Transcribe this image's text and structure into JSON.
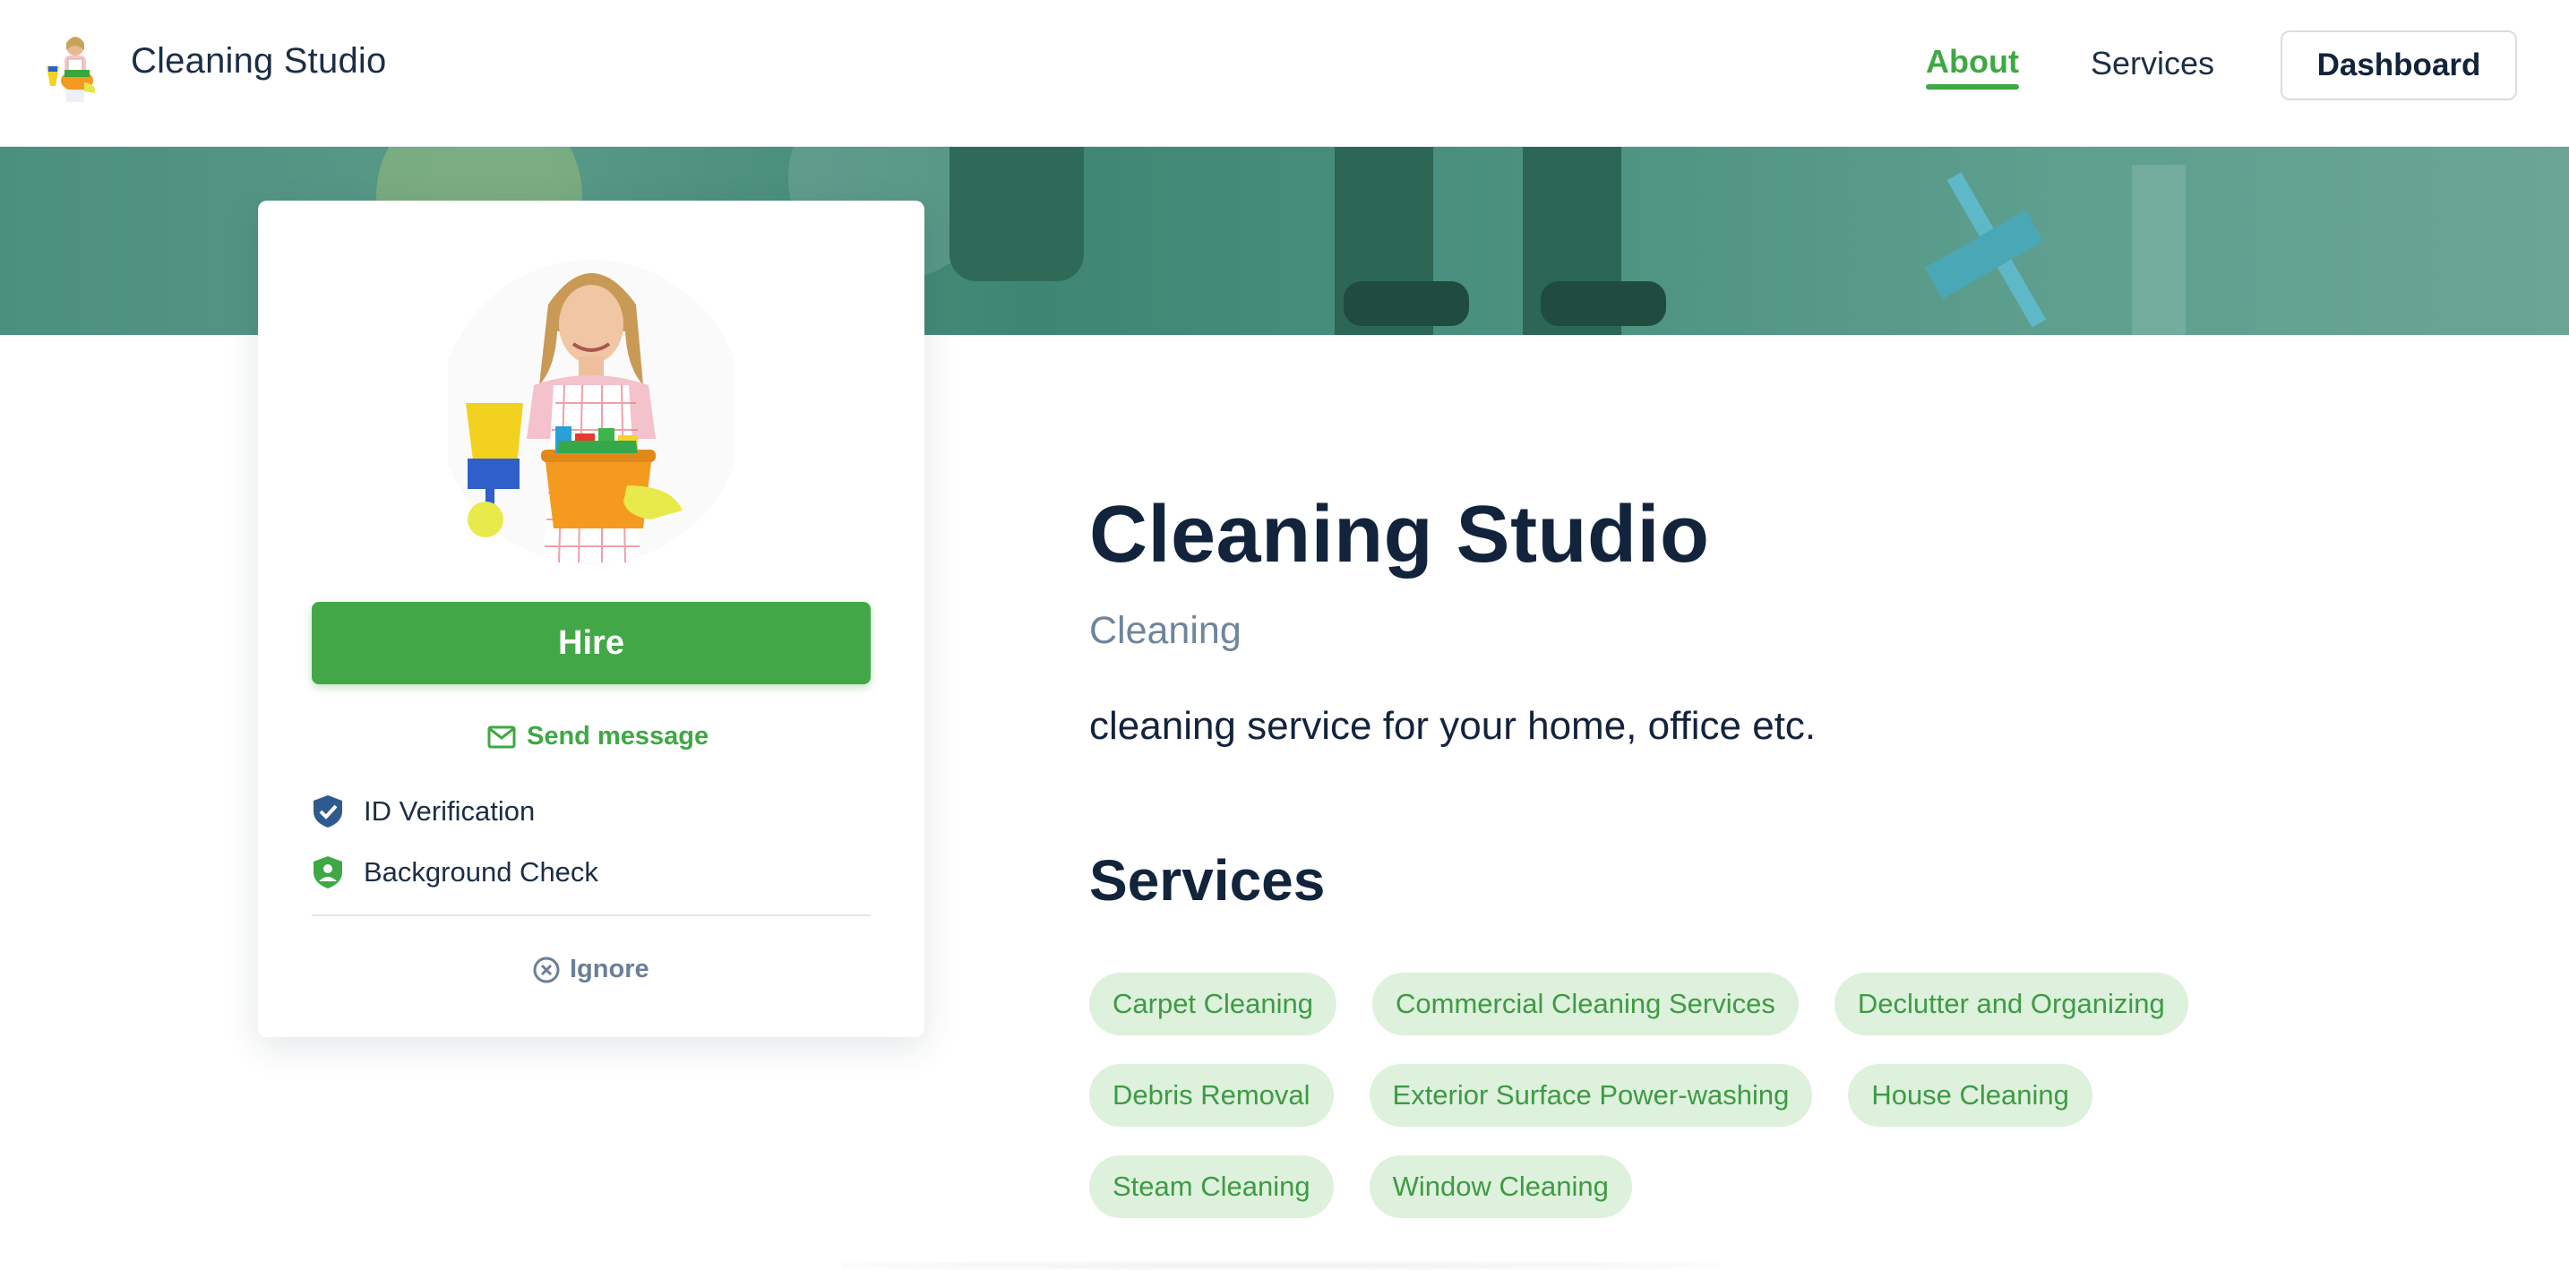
{
  "header": {
    "brand": "Cleaning Studio",
    "logo_icon": "cleaning-lady-logo",
    "nav": {
      "about": "About",
      "services": "Services"
    },
    "dashboard_label": "Dashboard"
  },
  "card": {
    "hire_label": "Hire",
    "send_message_label": "Send message",
    "verifications": [
      {
        "label": "ID Verification",
        "icon": "shield-check-icon",
        "color": "#2e5a8e"
      },
      {
        "label": "Background Check",
        "icon": "shield-user-icon",
        "color": "#3fa844"
      }
    ],
    "ignore_label": "Ignore"
  },
  "profile": {
    "name": "Cleaning Studio",
    "category": "Cleaning",
    "description": "cleaning service for your home, office etc."
  },
  "services": {
    "heading": "Services",
    "tags": [
      [
        "Carpet Cleaning",
        "Commercial Cleaning Services",
        "Declutter and Organizing"
      ],
      [
        "Debris Removal",
        "Exterior Surface Power-washing",
        "House Cleaning"
      ],
      [
        "Steam Cleaning",
        "Window Cleaning"
      ]
    ]
  },
  "colors": {
    "accent": "#3fa844",
    "heading": "#12233c",
    "tag_bg": "#ddf1dc"
  }
}
